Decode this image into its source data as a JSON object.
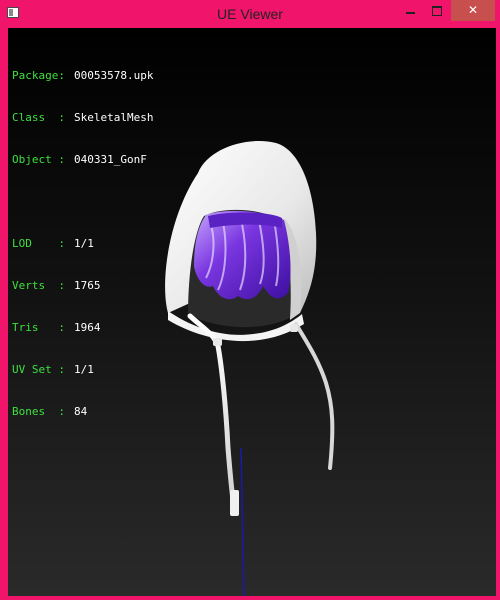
{
  "window": {
    "title": "UE Viewer",
    "icon": "app-icon",
    "controls": {
      "minimize": "minimize-icon",
      "maximize": "maximize-icon",
      "close": "close-icon"
    },
    "close_glyph": "✕",
    "accent_color": "#f0146a"
  },
  "info": {
    "package_key": "Package:",
    "package_value": "00053578.upk",
    "class_key": "Class  :",
    "class_value": "SkeletalMesh",
    "object_key": "Object :",
    "object_value": "040331_GonF",
    "lod_key": "LOD    :",
    "lod_value": "1/1",
    "verts_key": "Verts  :",
    "verts_value": "1765",
    "tris_key": "Tris   :",
    "tris_value": "1964",
    "uvset_key": "UV Set :",
    "uvset_value": "1/1",
    "bones_key": "Bones  :",
    "bones_value": "84",
    "label_color": "#3ee03e",
    "value_color": "#ffffff"
  },
  "scene": {
    "model": "white hood with purple hair mesh",
    "hood_color": "#f2f2f2",
    "hair_color": "#6a2fd0",
    "axis_color": "#1a1aa8"
  }
}
